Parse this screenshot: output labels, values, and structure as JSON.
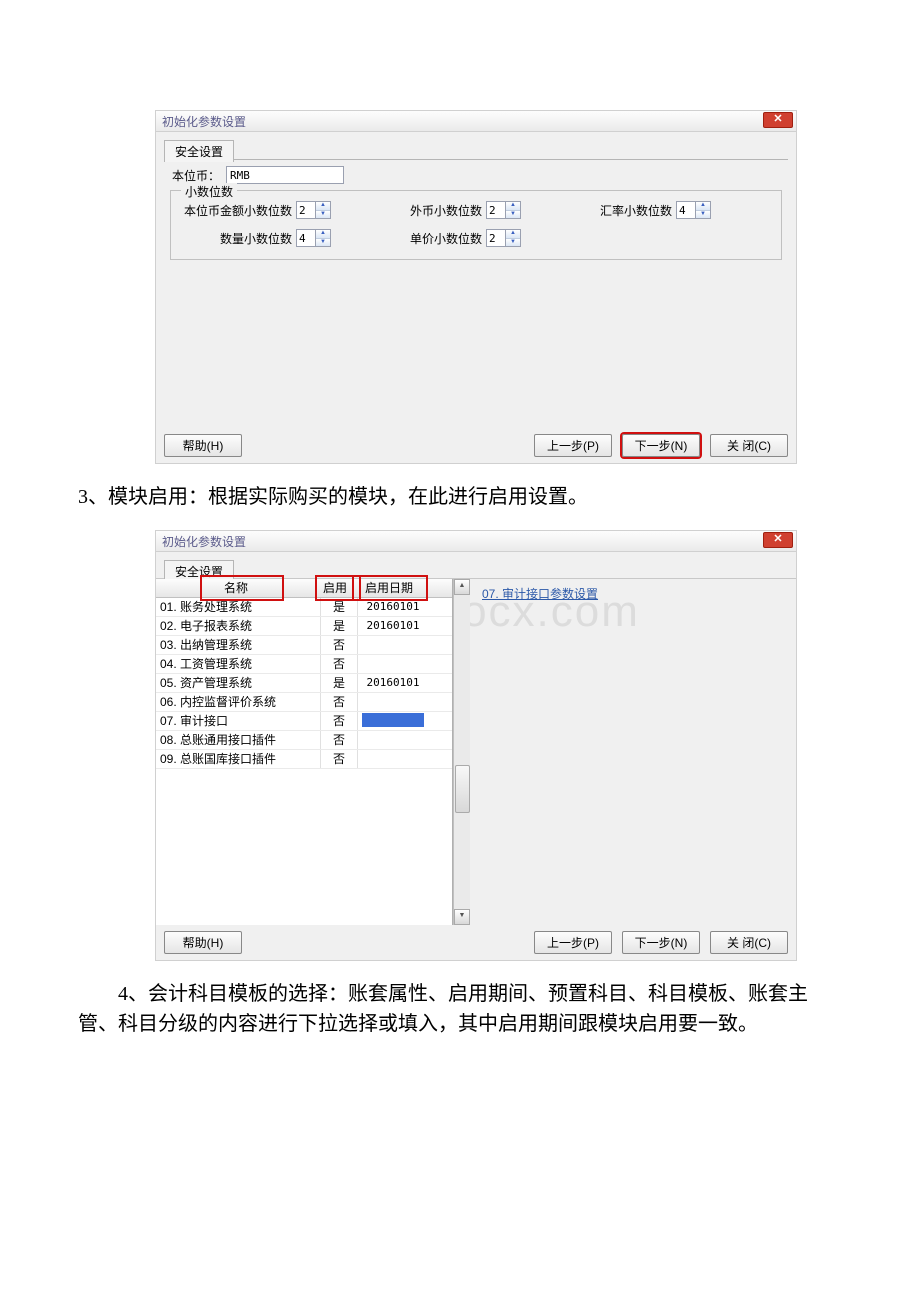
{
  "dialog1": {
    "title": "初始化参数设置",
    "close_glyph": "✕",
    "tab": "安全设置",
    "base_currency_label": "本位币：",
    "base_currency_value": "RMB",
    "group_legend": "小数位数",
    "spinners": {
      "base_amount": {
        "label": "本位币金额小数位数",
        "value": "2"
      },
      "foreign": {
        "label": "外币小数位数",
        "value": "2"
      },
      "rate": {
        "label": "汇率小数位数",
        "value": "4"
      },
      "qty": {
        "label": "数量小数位数",
        "value": "4"
      },
      "price": {
        "label": "单价小数位数",
        "value": "2"
      }
    },
    "buttons": {
      "help": "帮助(H)",
      "prev": "上一步(P)",
      "next": "下一步(N)",
      "close": "关 闭(C)"
    }
  },
  "para1": "3、模块启用：根据实际购买的模块，在此进行启用设置。",
  "dialog2": {
    "title": "初始化参数设置",
    "close_glyph": "✕",
    "tab": "安全设置",
    "right_link": "07. 审计接口参数设置",
    "headers": {
      "name": "名称",
      "enable": "启用",
      "date": "启用日期"
    },
    "rows": [
      {
        "name": "01. 账务处理系统",
        "enable": "是",
        "date": "20160101"
      },
      {
        "name": "02. 电子报表系统",
        "enable": "是",
        "date": "20160101"
      },
      {
        "name": "03. 出纳管理系统",
        "enable": "否",
        "date": ""
      },
      {
        "name": "04. 工资管理系统",
        "enable": "否",
        "date": ""
      },
      {
        "name": "05. 资产管理系统",
        "enable": "是",
        "date": "20160101"
      },
      {
        "name": "06. 内控监督评价系统",
        "enable": "否",
        "date": ""
      },
      {
        "name": "07. 审计接口",
        "enable": "否",
        "date": "__selected__"
      },
      {
        "name": "08. 总账通用接口插件",
        "enable": "否",
        "date": ""
      },
      {
        "name": "09. 总账国库接口插件",
        "enable": "否",
        "date": ""
      }
    ],
    "buttons": {
      "help": "帮助(H)",
      "prev": "上一步(P)",
      "next": "下一步(N)",
      "close": "关 闭(C)"
    }
  },
  "para2": "4、会计科目模板的选择：账套属性、启用期间、预置科目、科目模板、账套主管、科目分级的内容进行下拉选择或填入，其中启用期间跟模块启用要一致。",
  "watermark": "www.bdocx.com"
}
